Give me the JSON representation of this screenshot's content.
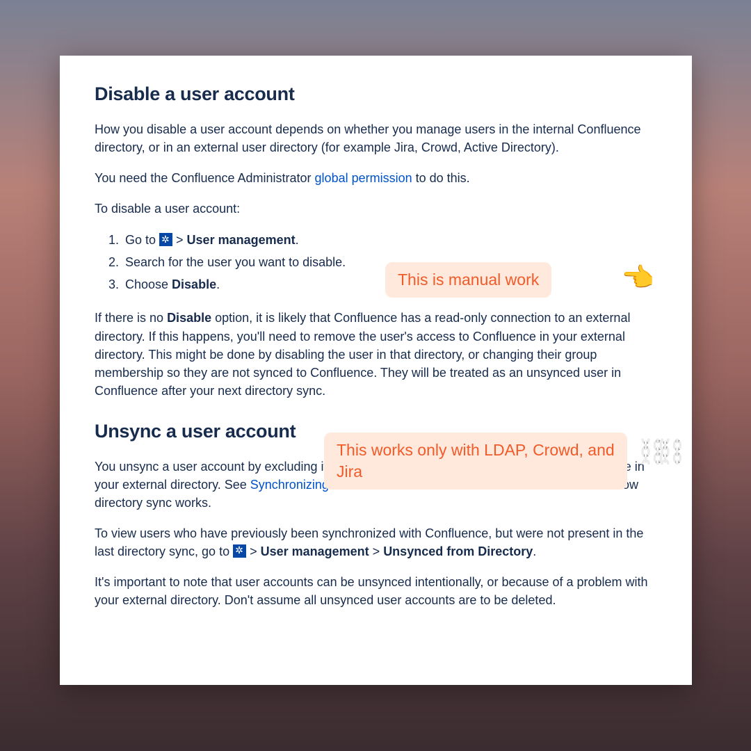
{
  "section1": {
    "title": "Disable a user account",
    "intro": "How you disable a user account depends on whether you manage users in the internal Confluence directory, or in an external user directory (for example Jira, Crowd, Active Directory).",
    "perm_pre": "You need the Confluence Administrator ",
    "perm_link": "global permission",
    "perm_post": " to do this.",
    "steps_lead": "To disable a user account:",
    "step1_pre": "Go to ",
    "step1_mid": " > ",
    "step1_bold": "User management",
    "step1_post": ".",
    "step2": "Search for the user you want to disable.",
    "step3_pre": "Choose ",
    "step3_bold": "Disable",
    "step3_post": ".",
    "note_pre": "If there is no ",
    "note_bold": "Disable",
    "note_post": " option, it is likely that Confluence has a read-only connection to an external directory. If this happens, you'll need to remove the user's access to Confluence in your external directory. This might be done by disabling the user in that directory, or changing their group membership so they are not synced to Confluence. They will be treated as an unsynced user in Confluence after your next directory sync."
  },
  "section2": {
    "title": "Unsync a user account",
    "p1_pre": "You unsync a user account by excluding it from the accounts to be synchronized with Confluence in your external directory.  See ",
    "p1_link": "Synchronizing Data from External Directories",
    "p1_post": " to learn more about how directory sync works.",
    "p2_pre": "To view users who have previously been synchronized with Confluence, but were not present in the last directory sync, go to ",
    "p2_mid1": " > ",
    "p2_bold1": "User management",
    "p2_mid2": " > ",
    "p2_bold2": "Unsynced from Directory",
    "p2_post": ".",
    "p3": "It's important to note that user accounts can be unsynced intentionally, or because of a problem with your external directory. Don't assume all unsynced user accounts are to be deleted."
  },
  "annotations": {
    "callout1": "This is manual work",
    "callout2": "This works only with LDAP, Crowd, and Jira",
    "hand_emoji": "👉",
    "chain_emoji": "⛓️"
  }
}
